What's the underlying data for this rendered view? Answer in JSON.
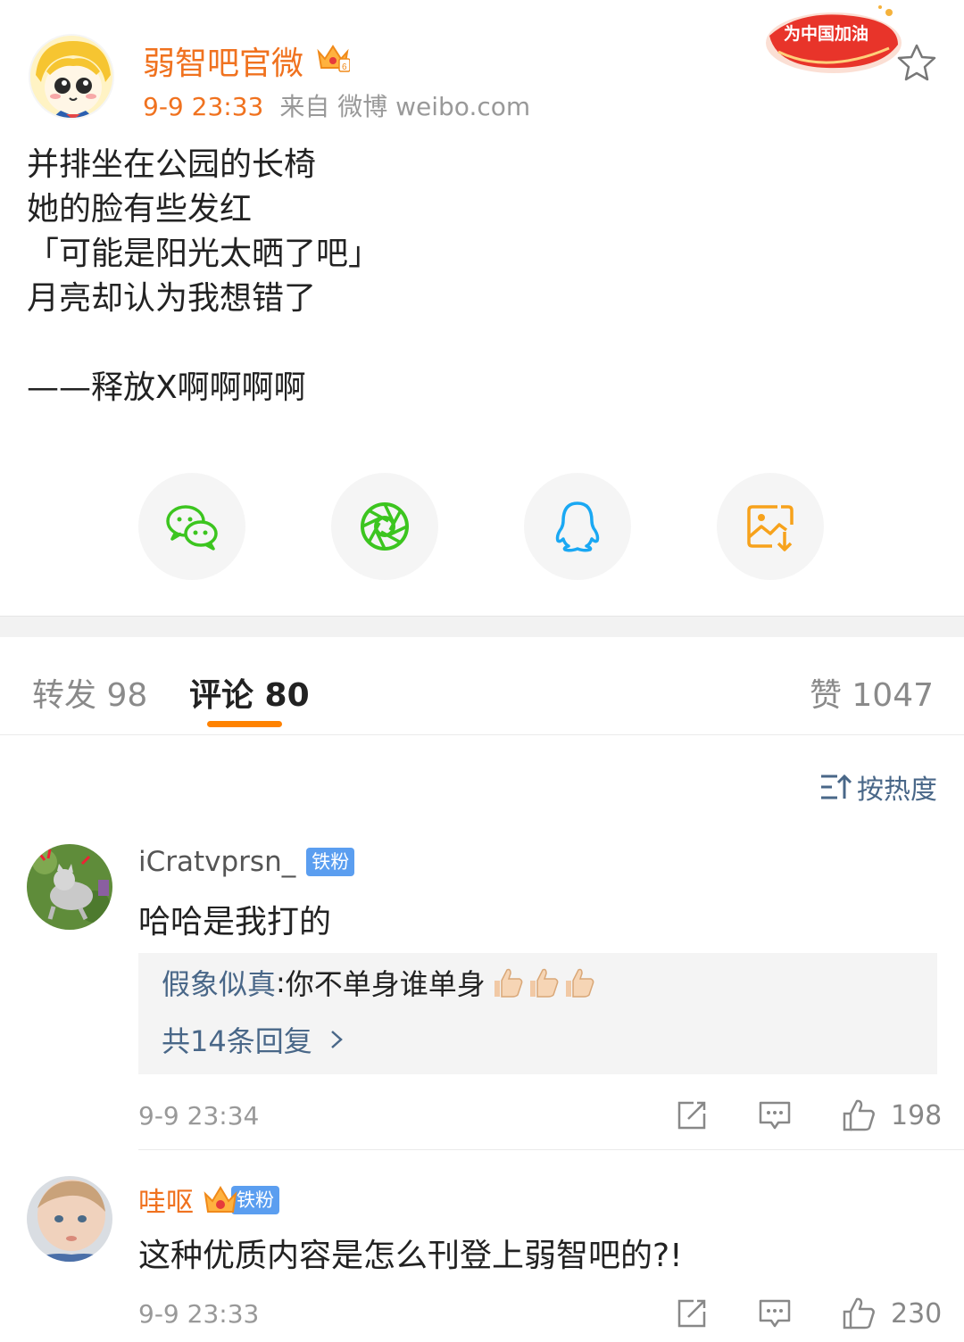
{
  "post": {
    "author": "弱智吧官微",
    "time": "9-9 23:33",
    "source": "来自 微博 weibo.com",
    "cheer_badge": "为中国加油",
    "lines": [
      "并排坐在公园的长椅",
      "她的脸有些发红",
      "「可能是阳光太晒了吧」",
      "月亮却认为我想错了",
      "",
      "——释放X啊啊啊啊"
    ]
  },
  "share": [
    {
      "icon": "wechat-icon",
      "color": "#3cc51f"
    },
    {
      "icon": "moments-icon",
      "color": "#3cc51f"
    },
    {
      "icon": "qq-icon",
      "color": "#1aa8f3"
    },
    {
      "icon": "save-image-icon",
      "color": "#f7a21b"
    }
  ],
  "tabs": {
    "repost": "转发 98",
    "comments": "评论 80",
    "likes": "赞 1047"
  },
  "sort_label": "按热度",
  "comments": [
    {
      "name": "iCratvprsn_",
      "badge": "铁粉",
      "text": "哈哈是我打的",
      "reply_name": "假象似真",
      "reply_sep": ": ",
      "reply_text": "你不单身谁单身",
      "reply_more": "共14条回复",
      "time": "9-9 23:34",
      "likes": "198"
    },
    {
      "name": "哇呕",
      "badge": "铁粉",
      "text": "这种优质内容是怎么刊登上弱智吧的?!",
      "time": "9-9 23:33",
      "likes": "230"
    }
  ],
  "colors": {
    "accent_orange": "#ff8200",
    "name_orange": "#f0721f",
    "link_blue": "#496788"
  }
}
